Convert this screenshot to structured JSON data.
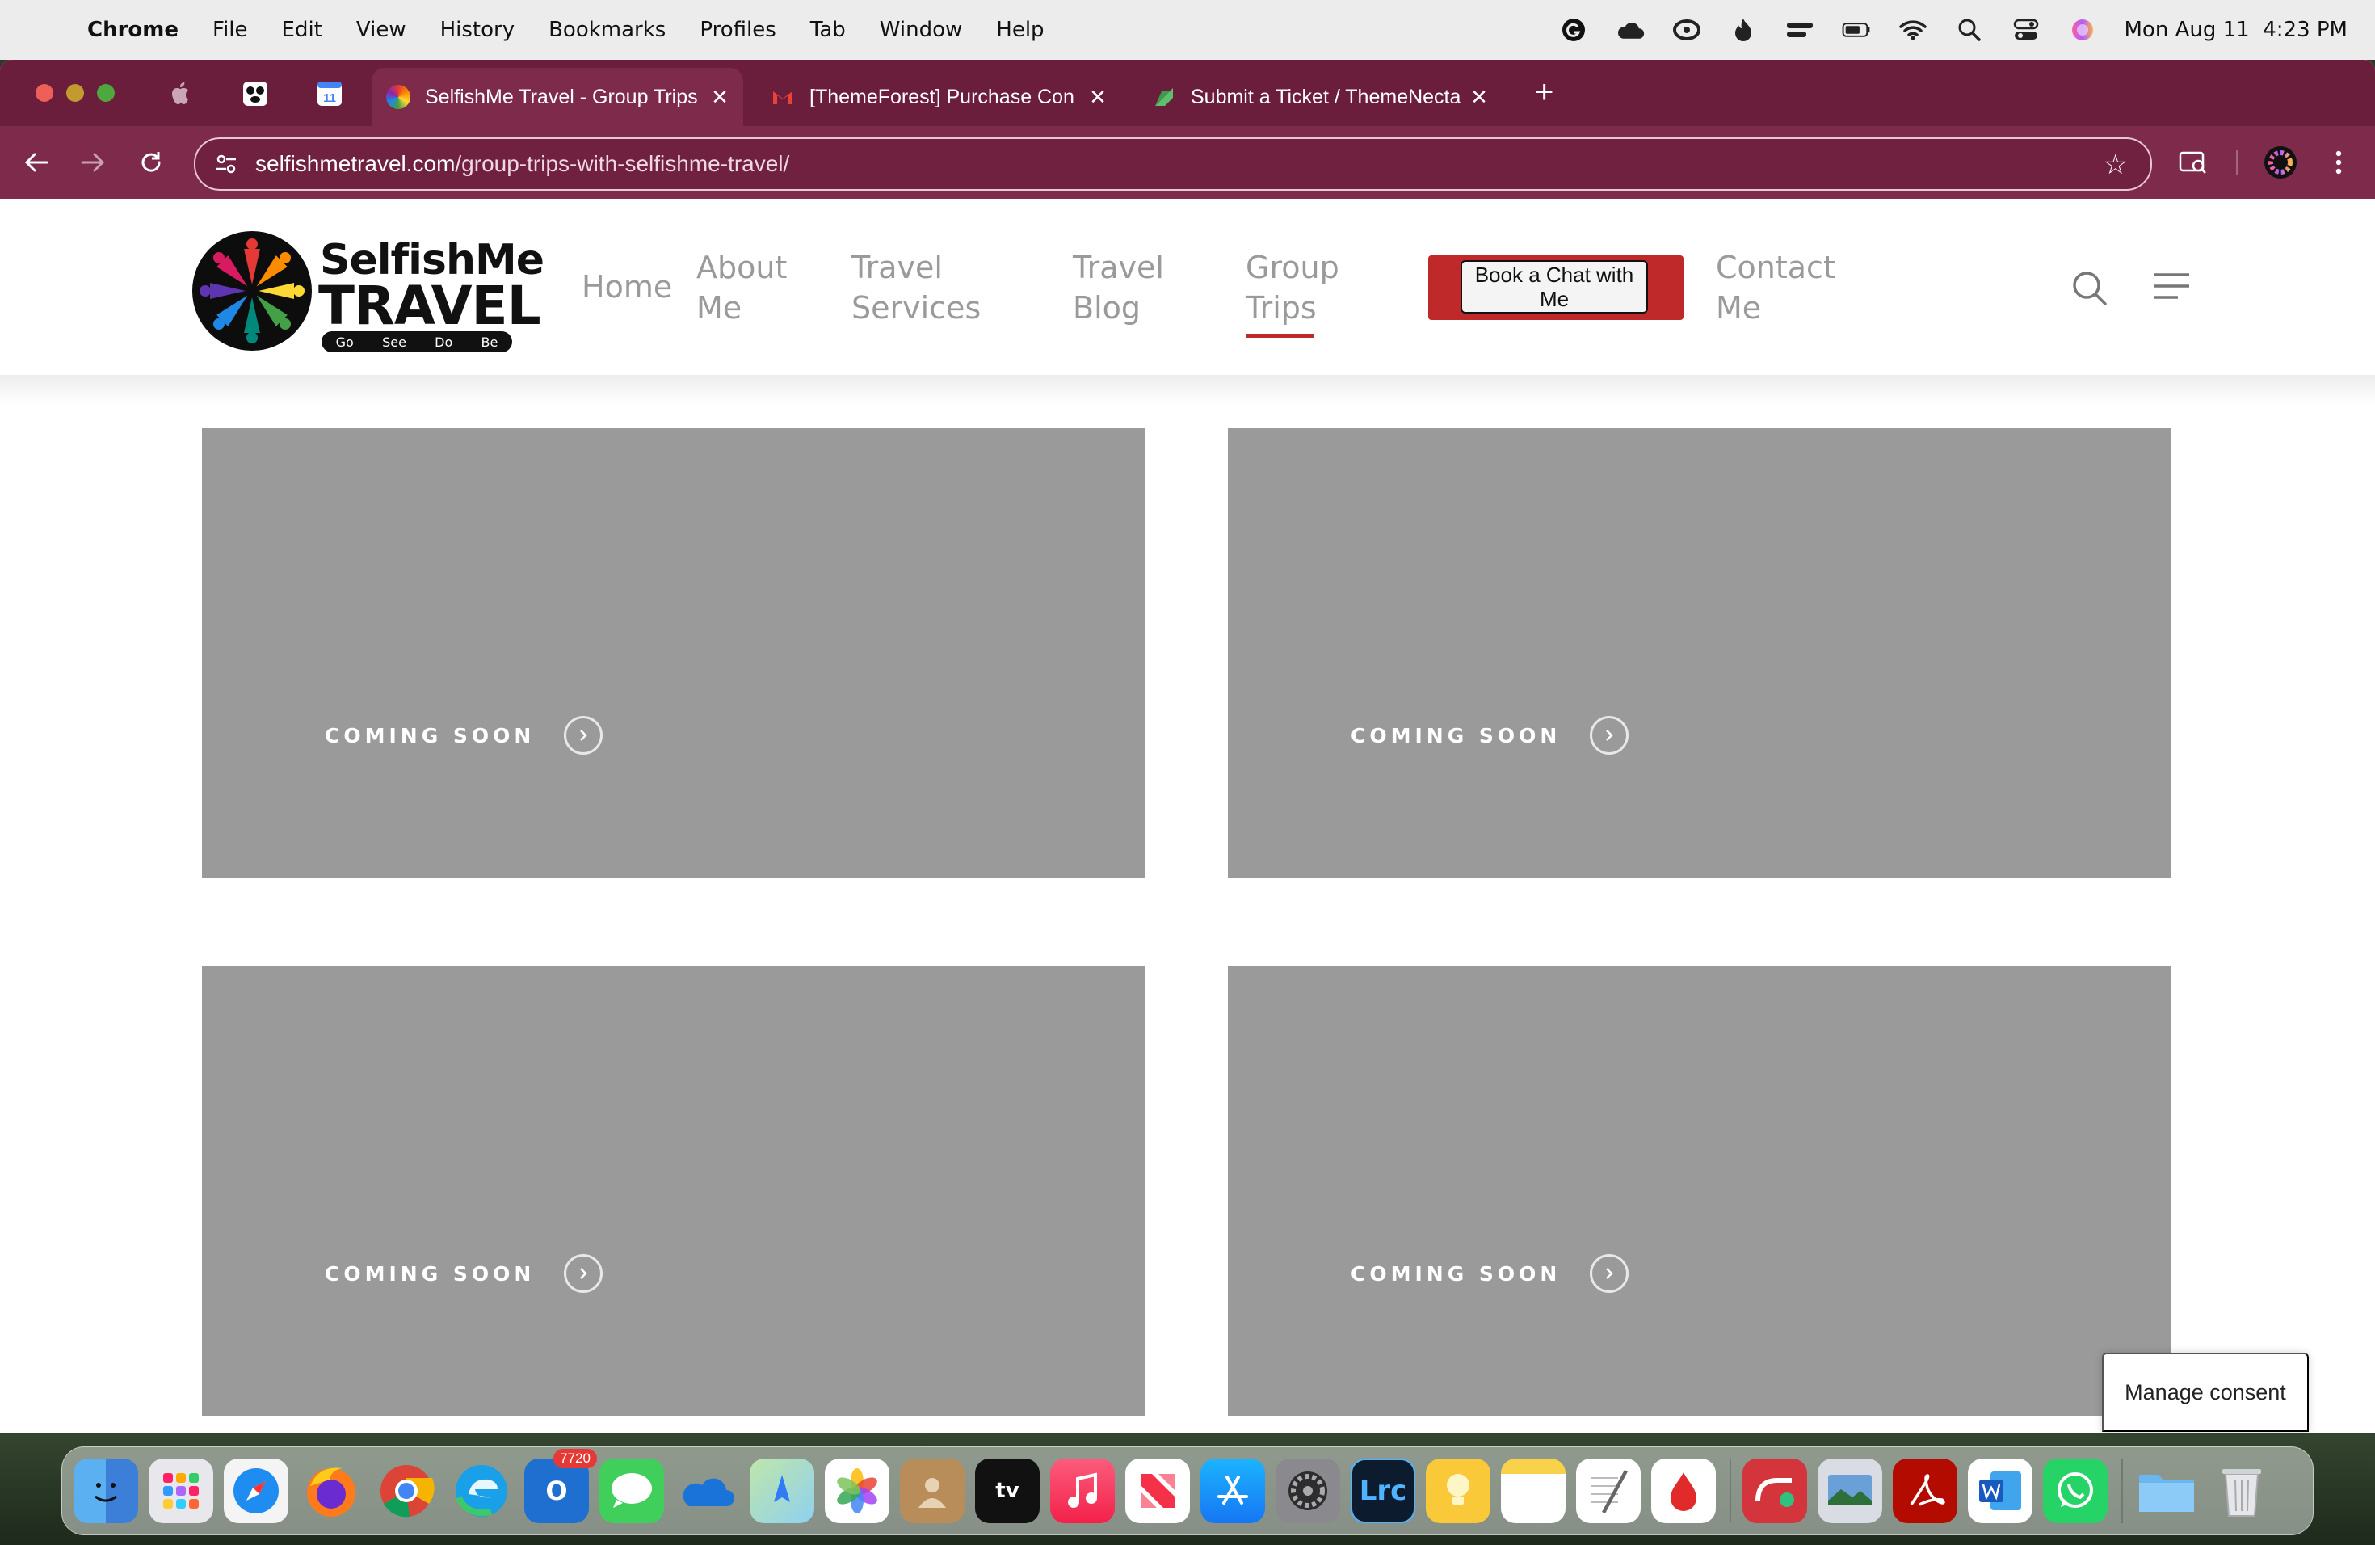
{
  "menubar": {
    "app": "Chrome",
    "items": [
      "File",
      "Edit",
      "View",
      "History",
      "Bookmarks",
      "Profiles",
      "Tab",
      "Window",
      "Help"
    ],
    "clock": "Mon Aug 11  4:23 PM"
  },
  "browser": {
    "tabs": [
      {
        "title": "SelfishMe Travel - Group Trips",
        "active": true
      },
      {
        "title": "[ThemeForest] Purchase Con",
        "active": false
      },
      {
        "title": "Submit a Ticket / ThemeNecta",
        "active": false
      }
    ],
    "pinned_calendar": "11",
    "url_host": "selfishmetravel.com",
    "url_path": "/group-trips-with-selfishme-travel/"
  },
  "site": {
    "logo": {
      "line1": "SelfishMe",
      "line2": "TRAVEL",
      "tagline": [
        "Go",
        "See",
        "Do",
        "Be"
      ]
    },
    "nav": [
      {
        "label": "Home"
      },
      {
        "label": "About Me"
      },
      {
        "label": "Travel Services"
      },
      {
        "label": "Travel Blog"
      },
      {
        "label": "Group Trips",
        "current": true
      },
      {
        "label": "Contact Me"
      }
    ],
    "cta_button": "Book a Chat with Me",
    "cards": [
      {
        "label": "COMING SOON"
      },
      {
        "label": "COMING SOON"
      },
      {
        "label": "COMING SOON"
      },
      {
        "label": "COMING SOON"
      }
    ],
    "consent": "Manage consent"
  },
  "dock": {
    "outlook_badge": "7720",
    "lightroom_label": "Lrc",
    "apps": [
      "Finder",
      "Launchpad",
      "Safari",
      "Firefox",
      "Chrome",
      "Edge",
      "Outlook",
      "Messages",
      "OneDrive",
      "Maps",
      "Photos",
      "Contacts",
      "TV",
      "Music",
      "News",
      "App Store",
      "System Settings",
      "Lightroom Classic",
      "Tips",
      "Notes",
      "TextEdit",
      "Acrobat Sign",
      "Express",
      "Preview",
      "Acrobat",
      "Word",
      "WhatsApp",
      "Downloads",
      "Trash"
    ]
  },
  "colors": {
    "tab_strip": "#6b1d3c",
    "toolbar": "#7e2a4a",
    "accent_red": "#c0292a",
    "card_gray": "#9a9a9a"
  }
}
